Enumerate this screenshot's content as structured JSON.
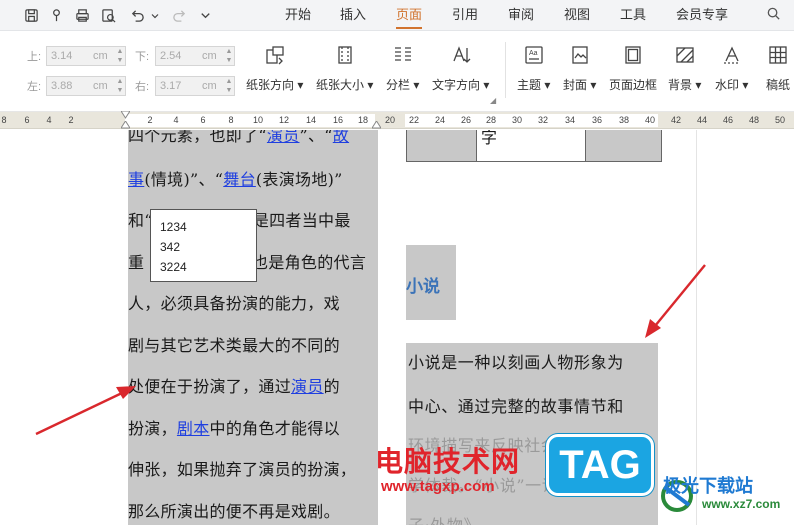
{
  "menubar": {
    "tabs": [
      "开始",
      "插入",
      "页面",
      "引用",
      "审阅",
      "视图",
      "工具",
      "会员专享"
    ],
    "active_tab": "页面",
    "accent_color": "#d1732e",
    "quick_access_icons": [
      "save-icon",
      "format-painter-icon",
      "print-icon",
      "print-preview-icon",
      "undo-icon",
      "redo-icon",
      "more-icon"
    ],
    "search_icon": "search-icon"
  },
  "ribbon": {
    "margins": {
      "top_label": "上:",
      "top_value": "3.14",
      "top_unit": "cm",
      "bottom_label": "下:",
      "bottom_value": "2.54",
      "bottom_unit": "cm",
      "left_label": "左:",
      "left_value": "3.88",
      "left_unit": "cm",
      "right_label": "右:",
      "right_value": "3.17",
      "right_unit": "cm"
    },
    "page_setup": {
      "orientation": "纸张方向",
      "size": "纸张大小",
      "columns": "分栏",
      "text_direction": "文字方向"
    },
    "background": {
      "theme": "主题",
      "cover": "封面",
      "page_border": "页面边框",
      "background": "背景",
      "watermark": "水印",
      "draft": "稿纸"
    }
  },
  "ruler": {
    "ticks": [
      "8",
      "6",
      "4",
      "2",
      "2",
      "4",
      "6",
      "8",
      "10",
      "12",
      "14",
      "16",
      "18",
      "20",
      "22",
      "24",
      "26",
      "28",
      "30",
      "32",
      "34",
      "36",
      "38",
      "40",
      "42",
      "44",
      "46",
      "48",
      "50"
    ]
  },
  "document": {
    "column1_lines": [
      {
        "parts": [
          {
            "t": "四个元素，也即了“"
          },
          {
            "t": "演员",
            "link": true
          },
          {
            "t": "”、“"
          },
          {
            "t": "故",
            "link": true
          }
        ]
      },
      {
        "parts": [
          {
            "t": "事",
            "link": true
          },
          {
            "t": "(情境)”、“"
          },
          {
            "t": "舞台",
            "link": true
          },
          {
            "t": "(表演场地)”"
          }
        ]
      },
      {
        "parts": [
          {
            "t": "和“"
          },
          {
            "t": "                 "
          },
          {
            "t": "”是四者当中最"
          }
        ]
      },
      {
        "parts": [
          {
            "t": "重"
          },
          {
            "t": "                    "
          },
          {
            "t": "也是角色的代言"
          }
        ]
      },
      {
        "parts": [
          {
            "t": "人，必须具备扮演的能力，戏"
          }
        ]
      },
      {
        "parts": [
          {
            "t": "剧与其它艺术类最大的不同的"
          }
        ]
      },
      {
        "parts": [
          {
            "t": "处便在于扮演了，通过"
          },
          {
            "t": "演员",
            "link": true
          },
          {
            "t": "的"
          }
        ]
      },
      {
        "parts": [
          {
            "t": "扮演，"
          },
          {
            "t": "剧本",
            "link": true
          },
          {
            "t": "中的角色才能得以"
          }
        ]
      },
      {
        "parts": [
          {
            "t": "伸张，如果抛弃了演员的扮演，"
          }
        ]
      },
      {
        "parts": [
          {
            "t": "那么所演出的便不再是戏剧。"
          }
        ]
      }
    ],
    "table_fragment_char": "字",
    "heading": "小说",
    "column2_lines": [
      {
        "text": "小说是一种以刻画人物形象为"
      },
      {
        "text": "中心、通过完整的故事情节和"
      },
      {
        "text": "环境描写来反映社会生活的文"
      },
      {
        "text": "学体裁。“小说”一词出自《"
      },
      {
        "text": "子·外物》"
      }
    ],
    "text_box_lines": [
      "1234",
      "342",
      "3224"
    ]
  },
  "watermarks": {
    "site_name": "电脑技术网",
    "site_url": "www.tagxp.com",
    "tag": "TAG",
    "jg_name": "极光下载站",
    "jg_url": "www.xz7.com"
  }
}
